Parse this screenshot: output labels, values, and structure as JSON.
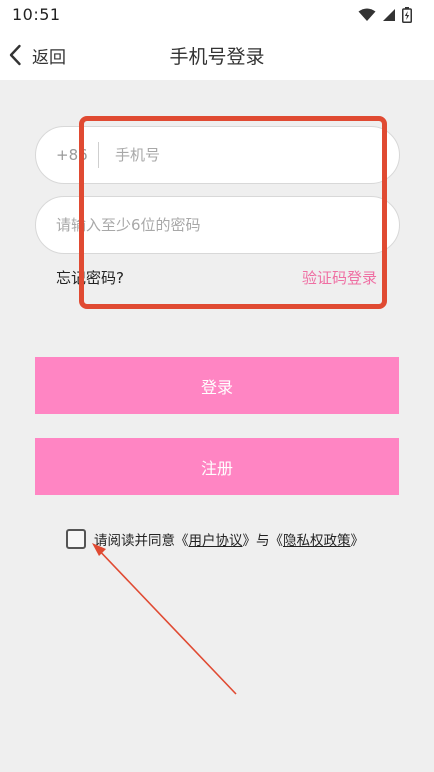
{
  "status_bar": {
    "time": "10:51"
  },
  "nav": {
    "back_label": "返回",
    "title": "手机号登录"
  },
  "form": {
    "country_code": "+86",
    "phone_placeholder": "手机号",
    "password_placeholder": "请输入至少6位的密码",
    "forgot_password": "忘记密码?",
    "sms_login": "验证码登录"
  },
  "buttons": {
    "login": "登录",
    "register": "注册"
  },
  "agreement": {
    "prefix": "请阅读并同意《",
    "user_agreement": "用户协议",
    "middle": "》与《",
    "privacy_policy": "隐私权政策",
    "suffix": "》",
    "checked": false
  },
  "colors": {
    "accent_pink": "#ff85c3",
    "link_pink": "#ef6fa3",
    "annotation_red": "#e04a32"
  },
  "icons": [
    "wifi-icon",
    "signal-icon",
    "battery-icon",
    "chevron-left-icon"
  ]
}
